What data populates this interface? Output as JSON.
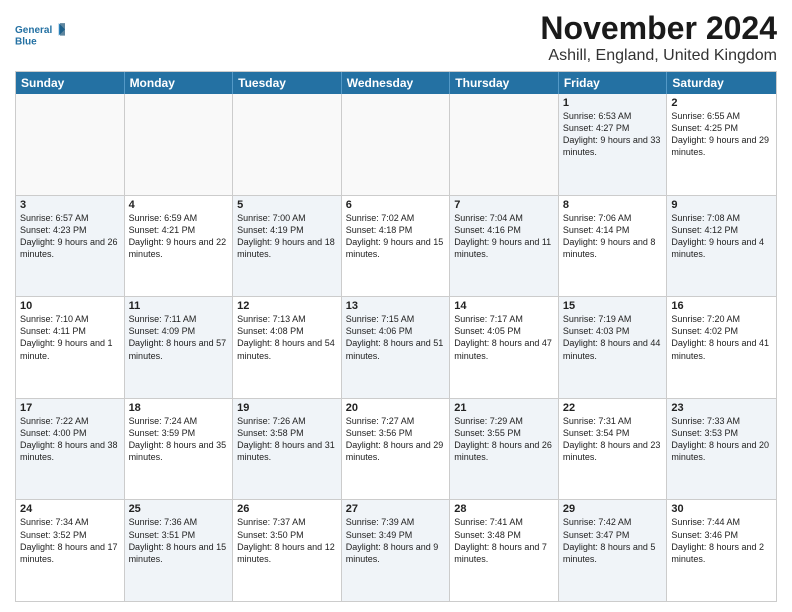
{
  "logo": {
    "text1": "General",
    "text2": "Blue"
  },
  "title": "November 2024",
  "subtitle": "Ashill, England, United Kingdom",
  "headers": [
    "Sunday",
    "Monday",
    "Tuesday",
    "Wednesday",
    "Thursday",
    "Friday",
    "Saturday"
  ],
  "rows": [
    [
      {
        "day": "",
        "info": "",
        "empty": true
      },
      {
        "day": "",
        "info": "",
        "empty": true
      },
      {
        "day": "",
        "info": "",
        "empty": true
      },
      {
        "day": "",
        "info": "",
        "empty": true
      },
      {
        "day": "",
        "info": "",
        "empty": true
      },
      {
        "day": "1",
        "info": "Sunrise: 6:53 AM\nSunset: 4:27 PM\nDaylight: 9 hours and 33 minutes.",
        "shaded": true
      },
      {
        "day": "2",
        "info": "Sunrise: 6:55 AM\nSunset: 4:25 PM\nDaylight: 9 hours and 29 minutes.",
        "shaded": false
      }
    ],
    [
      {
        "day": "3",
        "info": "Sunrise: 6:57 AM\nSunset: 4:23 PM\nDaylight: 9 hours and 26 minutes.",
        "shaded": true
      },
      {
        "day": "4",
        "info": "Sunrise: 6:59 AM\nSunset: 4:21 PM\nDaylight: 9 hours and 22 minutes.",
        "shaded": false
      },
      {
        "day": "5",
        "info": "Sunrise: 7:00 AM\nSunset: 4:19 PM\nDaylight: 9 hours and 18 minutes.",
        "shaded": true
      },
      {
        "day": "6",
        "info": "Sunrise: 7:02 AM\nSunset: 4:18 PM\nDaylight: 9 hours and 15 minutes.",
        "shaded": false
      },
      {
        "day": "7",
        "info": "Sunrise: 7:04 AM\nSunset: 4:16 PM\nDaylight: 9 hours and 11 minutes.",
        "shaded": true
      },
      {
        "day": "8",
        "info": "Sunrise: 7:06 AM\nSunset: 4:14 PM\nDaylight: 9 hours and 8 minutes.",
        "shaded": false
      },
      {
        "day": "9",
        "info": "Sunrise: 7:08 AM\nSunset: 4:12 PM\nDaylight: 9 hours and 4 minutes.",
        "shaded": true
      }
    ],
    [
      {
        "day": "10",
        "info": "Sunrise: 7:10 AM\nSunset: 4:11 PM\nDaylight: 9 hours and 1 minute.",
        "shaded": false
      },
      {
        "day": "11",
        "info": "Sunrise: 7:11 AM\nSunset: 4:09 PM\nDaylight: 8 hours and 57 minutes.",
        "shaded": true
      },
      {
        "day": "12",
        "info": "Sunrise: 7:13 AM\nSunset: 4:08 PM\nDaylight: 8 hours and 54 minutes.",
        "shaded": false
      },
      {
        "day": "13",
        "info": "Sunrise: 7:15 AM\nSunset: 4:06 PM\nDaylight: 8 hours and 51 minutes.",
        "shaded": true
      },
      {
        "day": "14",
        "info": "Sunrise: 7:17 AM\nSunset: 4:05 PM\nDaylight: 8 hours and 47 minutes.",
        "shaded": false
      },
      {
        "day": "15",
        "info": "Sunrise: 7:19 AM\nSunset: 4:03 PM\nDaylight: 8 hours and 44 minutes.",
        "shaded": true
      },
      {
        "day": "16",
        "info": "Sunrise: 7:20 AM\nSunset: 4:02 PM\nDaylight: 8 hours and 41 minutes.",
        "shaded": false
      }
    ],
    [
      {
        "day": "17",
        "info": "Sunrise: 7:22 AM\nSunset: 4:00 PM\nDaylight: 8 hours and 38 minutes.",
        "shaded": true
      },
      {
        "day": "18",
        "info": "Sunrise: 7:24 AM\nSunset: 3:59 PM\nDaylight: 8 hours and 35 minutes.",
        "shaded": false
      },
      {
        "day": "19",
        "info": "Sunrise: 7:26 AM\nSunset: 3:58 PM\nDaylight: 8 hours and 31 minutes.",
        "shaded": true
      },
      {
        "day": "20",
        "info": "Sunrise: 7:27 AM\nSunset: 3:56 PM\nDaylight: 8 hours and 29 minutes.",
        "shaded": false
      },
      {
        "day": "21",
        "info": "Sunrise: 7:29 AM\nSunset: 3:55 PM\nDaylight: 8 hours and 26 minutes.",
        "shaded": true
      },
      {
        "day": "22",
        "info": "Sunrise: 7:31 AM\nSunset: 3:54 PM\nDaylight: 8 hours and 23 minutes.",
        "shaded": false
      },
      {
        "day": "23",
        "info": "Sunrise: 7:33 AM\nSunset: 3:53 PM\nDaylight: 8 hours and 20 minutes.",
        "shaded": true
      }
    ],
    [
      {
        "day": "24",
        "info": "Sunrise: 7:34 AM\nSunset: 3:52 PM\nDaylight: 8 hours and 17 minutes.",
        "shaded": false
      },
      {
        "day": "25",
        "info": "Sunrise: 7:36 AM\nSunset: 3:51 PM\nDaylight: 8 hours and 15 minutes.",
        "shaded": true
      },
      {
        "day": "26",
        "info": "Sunrise: 7:37 AM\nSunset: 3:50 PM\nDaylight: 8 hours and 12 minutes.",
        "shaded": false
      },
      {
        "day": "27",
        "info": "Sunrise: 7:39 AM\nSunset: 3:49 PM\nDaylight: 8 hours and 9 minutes.",
        "shaded": true
      },
      {
        "day": "28",
        "info": "Sunrise: 7:41 AM\nSunset: 3:48 PM\nDaylight: 8 hours and 7 minutes.",
        "shaded": false
      },
      {
        "day": "29",
        "info": "Sunrise: 7:42 AM\nSunset: 3:47 PM\nDaylight: 8 hours and 5 minutes.",
        "shaded": true
      },
      {
        "day": "30",
        "info": "Sunrise: 7:44 AM\nSunset: 3:46 PM\nDaylight: 8 hours and 2 minutes.",
        "shaded": false
      }
    ]
  ]
}
